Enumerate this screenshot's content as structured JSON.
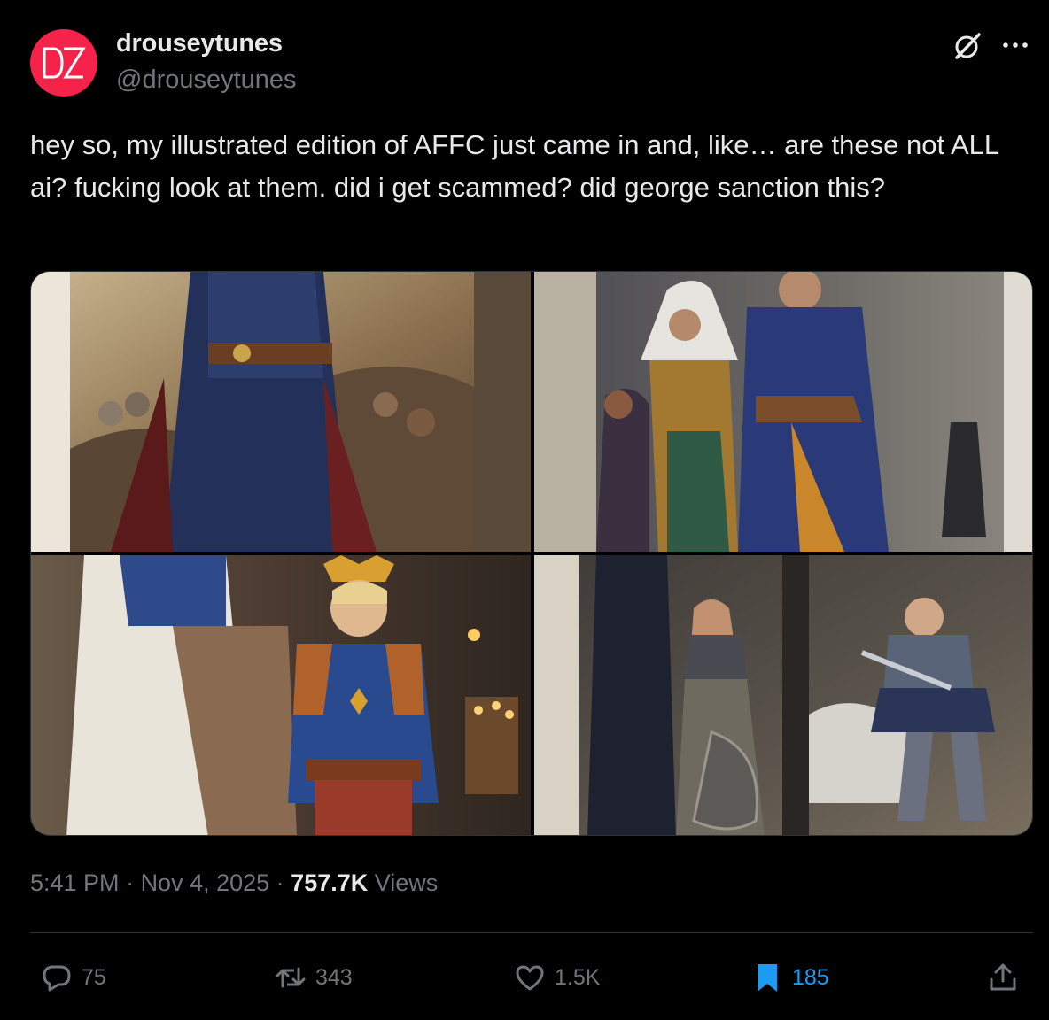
{
  "author": {
    "display_name": "drouseytunes",
    "handle": "@drouseytunes",
    "avatar_color": "#f5224a"
  },
  "tweet": {
    "text": "hey so, my illustrated edition of AFFC just came in and, like… are these not ALL ai? fucking look at them. did i get scammed? did george sanction this?",
    "time": "5:41 PM",
    "date": "Nov 4, 2025",
    "views_count": "757.7K",
    "views_label": "Views",
    "separator": " · "
  },
  "media": [
    {
      "icon": "book-illustration-knight-crowd"
    },
    {
      "icon": "book-illustration-hooded-figures"
    },
    {
      "icon": "book-illustration-boy-king"
    },
    {
      "icon": "book-illustration-armored-knight"
    }
  ],
  "actions": {
    "replies": "75",
    "reposts": "343",
    "likes": "1.5K",
    "bookmarks": "185"
  },
  "colors": {
    "background": "#000000",
    "text": "#e7e9ea",
    "muted": "#71767b",
    "accent": "#1d9bf0",
    "divider": "#2f3336"
  }
}
